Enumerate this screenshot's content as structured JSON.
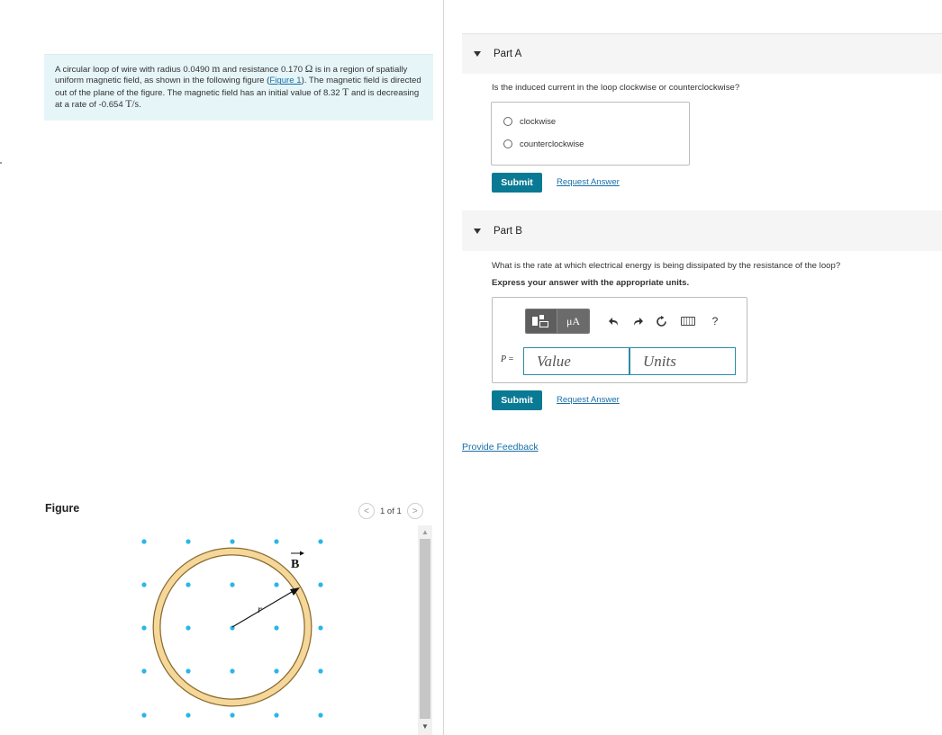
{
  "problem": {
    "t1": "A circular loop of wire with radius 0.0490 ",
    "u1": "m",
    "t2": " and resistance 0.170 ",
    "u2": "Ω",
    "t3": " is in a region of spatially uniform magnetic field, as shown in the following figure (",
    "link": "Figure 1",
    "t4": "). The magnetic field is directed out of the plane of the figure. The magnetic field has an initial value of 8.32 ",
    "u3": "T",
    "t5": " and is decreasing at a rate of -0.654 ",
    "u4": "T/s",
    "t6": "."
  },
  "figure": {
    "label": "Figure",
    "pager_text": "1 of 1",
    "prev_glyph": "<",
    "next_glyph": ">",
    "b_label": "B",
    "r_label": "r",
    "colors": {
      "dot": "#29b6e8",
      "ring": "#f5d79a",
      "ring_edge": "#8a6a2e"
    }
  },
  "part_a": {
    "title": "Part A",
    "question": "Is the induced current in the loop clockwise or counterclockwise?",
    "options": [
      {
        "label": "clockwise",
        "selected": false
      },
      {
        "label": "counterclockwise",
        "selected": false
      }
    ],
    "submit_label": "Submit",
    "request_label": "Request Answer"
  },
  "part_b": {
    "title": "Part B",
    "question": "What is the rate at which electrical energy is being dissipated by the resistance of the loop?",
    "instruction": "Express your answer with the appropriate units.",
    "toolbar": {
      "templates_icon": "templates-icon",
      "units_btn": "μA",
      "undo_icon": "undo-icon",
      "redo_icon": "redo-icon",
      "reset_icon": "reset-icon",
      "keyboard_icon": "keyboard-icon",
      "help_label": "?"
    },
    "var_label": "P",
    "equals": "=",
    "value_placeholder": "Value",
    "units_placeholder": "Units",
    "submit_label": "Submit",
    "request_label": "Request Answer"
  },
  "feedback_label": "Provide Feedback",
  "colors": {
    "accent": "#0a7a94",
    "link": "#1a70a8",
    "problem_bg": "#e6f5f8"
  }
}
